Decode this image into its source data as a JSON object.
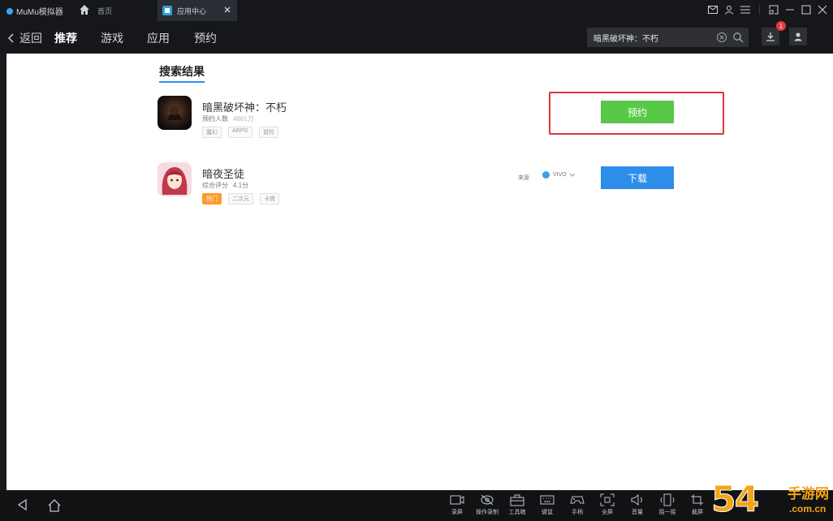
{
  "titlebar": {
    "app_name": "MuMu模拟器",
    "home_label": "首页",
    "active_tab": "应用中心"
  },
  "nav": {
    "back_label": "返回",
    "tabs": [
      "推荐",
      "游戏",
      "应用",
      "预约"
    ],
    "search_value": "暗黑破坏神：不朽",
    "download_badge": "1"
  },
  "content": {
    "section_title": "搜索结果",
    "results": [
      {
        "name": "暗黑破坏神：不朽",
        "meta": [
          "预约人数",
          "4861万"
        ],
        "tags": [
          "魔幻",
          "ARPG",
          "冒险"
        ],
        "action": "预约"
      },
      {
        "name": "暗夜圣徒",
        "meta": [
          "综合评分",
          "4.1分"
        ],
        "tags": [
          "热门",
          "二次元",
          "卡牌"
        ],
        "source_label": "来源",
        "source_name": "VIVO",
        "action": "下载"
      }
    ]
  },
  "bottom_tools": [
    {
      "icon": "record-icon",
      "label": "录屏"
    },
    {
      "icon": "gamepad-eye-icon",
      "label": "操作录制"
    },
    {
      "icon": "toolbox-icon",
      "label": "工具箱"
    },
    {
      "icon": "keyboard-icon",
      "label": "键鼠"
    },
    {
      "icon": "controller-icon",
      "label": "手柄"
    },
    {
      "icon": "fullscreen-icon",
      "label": "全屏"
    },
    {
      "icon": "volume-icon",
      "label": "音量"
    },
    {
      "icon": "shake-icon",
      "label": "摇一摇"
    },
    {
      "icon": "crop-icon",
      "label": "截屏"
    }
  ],
  "watermark": {
    "number": "54",
    "cn": "手游网",
    "domain": ".com.cn"
  },
  "colors": {
    "reserve_green": "#59c848",
    "download_blue": "#2c8ee8",
    "highlight_red": "#d9363e",
    "underline_blue": "#2a8ff0"
  }
}
